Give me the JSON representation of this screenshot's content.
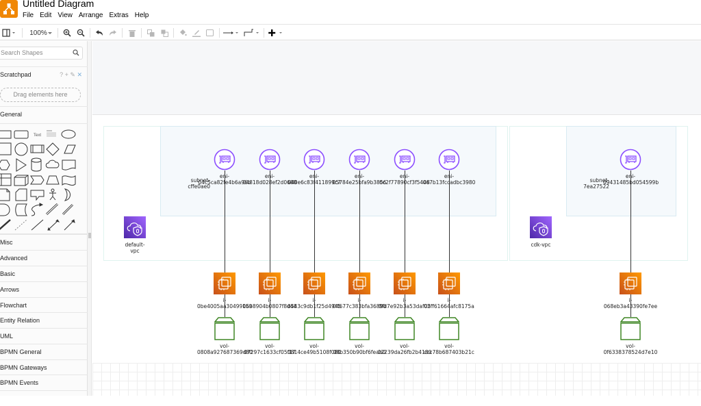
{
  "app": {
    "title": "Untitled Diagram",
    "logo_icon": "drawio-logo-icon",
    "menu": [
      "File",
      "Edit",
      "View",
      "Arrange",
      "Extras",
      "Help"
    ]
  },
  "toolbar": {
    "zoom_level": "100%",
    "buttons": [
      "format-panel",
      "zoom-in",
      "zoom-out",
      "undo",
      "redo",
      "delete",
      "to-front",
      "to-back",
      "fill-color",
      "line-color",
      "shadow",
      "connection",
      "waypoints",
      "insert"
    ]
  },
  "sidebar": {
    "search_placeholder": "Search Shapes",
    "scratchpad": {
      "title": "Scratchpad",
      "tools": "? + ✎",
      "close": "✕",
      "drop_hint": "Drag elements here"
    },
    "general_title": "General",
    "shape_texts": {
      "text": "Text",
      "heading": "Heading"
    },
    "categories": [
      "Misc",
      "Advanced",
      "Basic",
      "Arrows",
      "Flowchart",
      "Entity Relation",
      "UML",
      "BPMN General",
      "BPMN Gateways",
      "BPMN Events"
    ]
  },
  "diagram": {
    "vpcs": [
      {
        "name": "default-vpc",
        "label": "default-\nvpc"
      },
      {
        "name": "cdk-vpc",
        "label": "cdk-vpc"
      }
    ],
    "subnets": [
      {
        "label_line1": "subnet-",
        "label_line2": "cffe0ae0"
      },
      {
        "label_line1": "subnet-",
        "label_line2": "7ea27522"
      }
    ],
    "enis": [
      {
        "prefix": "eni-",
        "id": "04c5ca82fe4b6a96b"
      },
      {
        "prefix": "eni-",
        "id": "04818d028ef2d0688"
      },
      {
        "prefix": "eni-",
        "id": "040e6c83f411899c7"
      },
      {
        "prefix": "eni-",
        "id": "05784e25bfa9b3856"
      },
      {
        "prefix": "eni-",
        "id": "0c2f77890cf3f5448"
      },
      {
        "prefix": "eni-",
        "id": "067b13fccadbc3980"
      },
      {
        "prefix": "eni-",
        "id": "09431485bd054599b"
      }
    ],
    "instances": [
      {
        "prefix": "i-",
        "id": "0be4005aa30499159"
      },
      {
        "prefix": "i-",
        "id": "06b8904b0807f8d48"
      },
      {
        "prefix": "i-",
        "id": "0543c9db1f25d4945"
      },
      {
        "prefix": "i-",
        "id": "04677c383bfa36890"
      },
      {
        "prefix": "i-",
        "id": "0fd7e92b3a53daf05"
      },
      {
        "prefix": "i-",
        "id": "02ff61664afc8175a"
      },
      {
        "prefix": "i-",
        "id": "068eb3a43390fe7ee"
      }
    ],
    "volumes": [
      {
        "prefix": "vol-",
        "id": "0808a927687369d80"
      },
      {
        "prefix": "vol-",
        "id": "07297c1633cf05f17"
      },
      {
        "prefix": "vol-",
        "id": "0814ce49b5108f080"
      },
      {
        "prefix": "vol-",
        "id": "08b350b90bf6feab0"
      },
      {
        "prefix": "vol-",
        "id": "02239da26fb2b4180"
      },
      {
        "prefix": "vol-",
        "id": "ccc78b687403b21c"
      },
      {
        "prefix": "vol-",
        "id": "0f6338378524d7e10"
      }
    ],
    "colors": {
      "eni": "#8c4fff",
      "ec2": "#ed7100",
      "ebs": "#3f8624",
      "vpc": "#8c4fff"
    }
  }
}
